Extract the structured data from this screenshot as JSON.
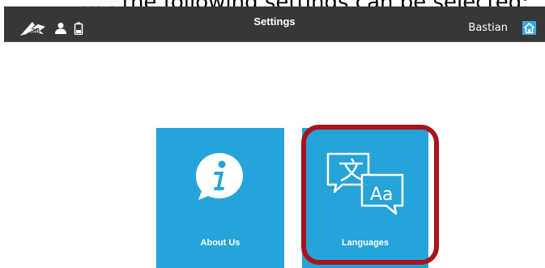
{
  "caption": {
    "text": "… , the following settings can be selected:"
  },
  "header": {
    "title": "Settings",
    "user_name": "Bastian",
    "icons": {
      "logo": "3b-logo-icon",
      "user": "user-icon",
      "battery": "battery-icon",
      "home": "home-icon"
    }
  },
  "tiles": [
    {
      "label": "About Us",
      "icon": "info-icon"
    },
    {
      "label": "Languages",
      "icon": "translate-icon",
      "highlighted": true
    }
  ],
  "colors": {
    "header_bg": "#373737",
    "tile_bg": "#26a3d8",
    "highlight": "#a8141c",
    "home_icon": "#3aa9e0"
  }
}
